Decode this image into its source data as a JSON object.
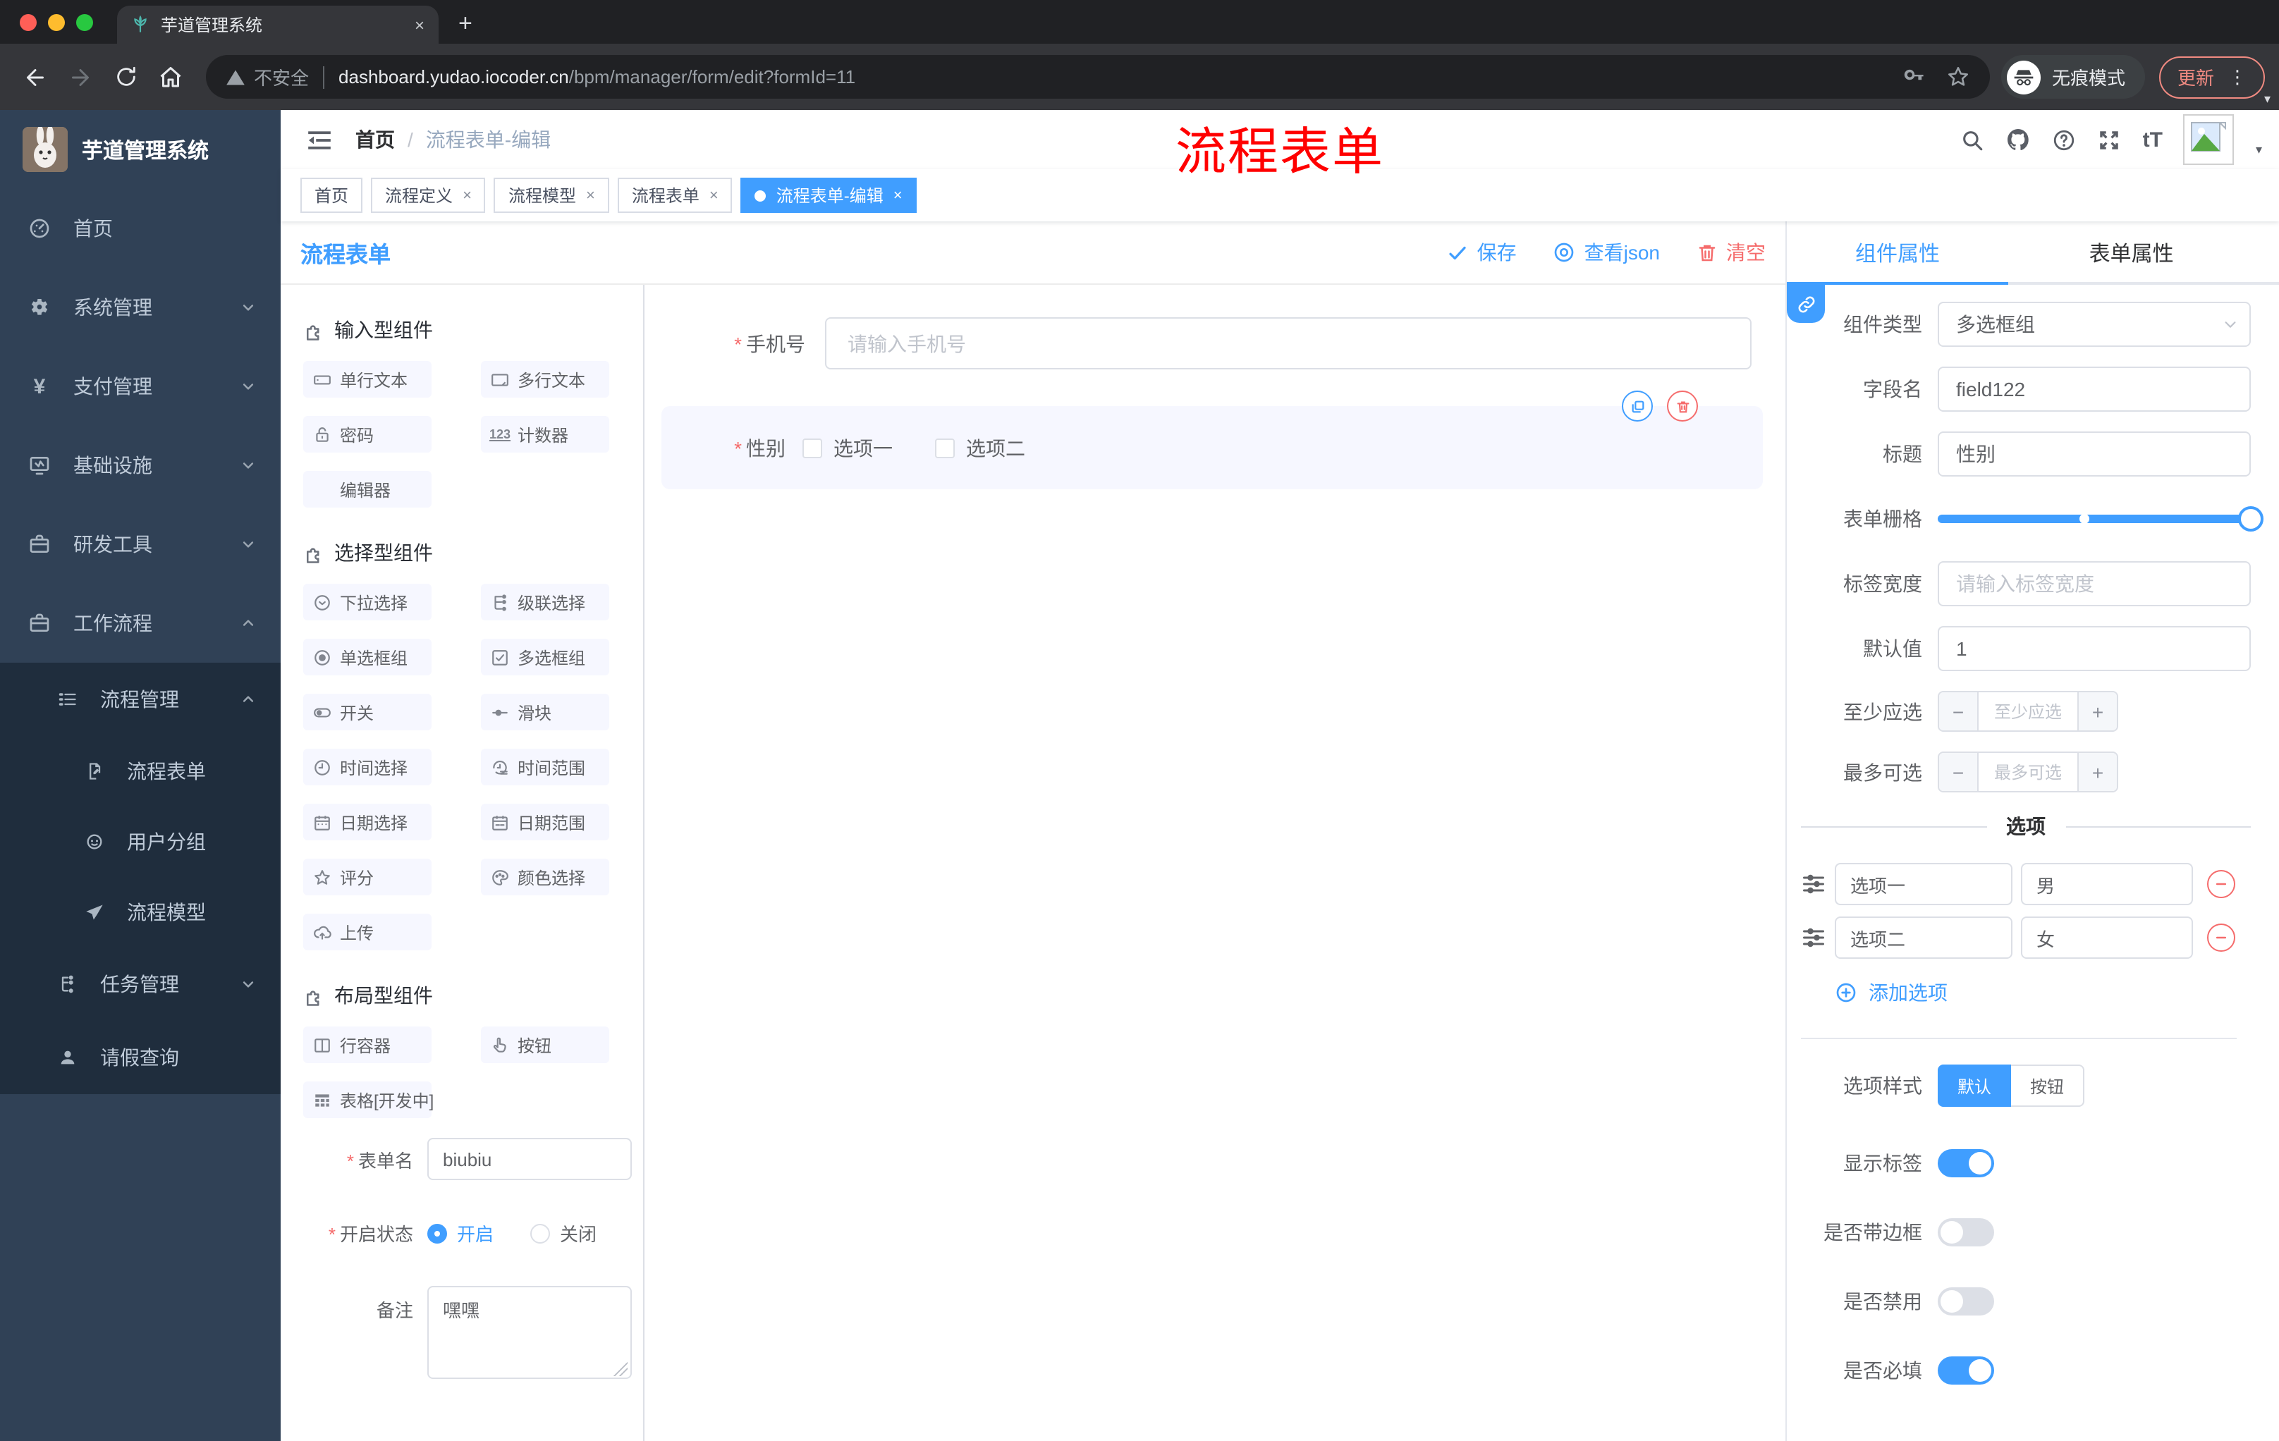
{
  "ui": {
    "close": "×",
    "plus": "+",
    "minus": "−",
    "caret": "▾",
    "dots": "⋮",
    "slash": "/"
  },
  "browser": {
    "tab_title": "芋道管理系统",
    "security_label": "不安全",
    "url_host": "dashboard.yudao.iocoder.cn",
    "url_path": "/bpm/manager/form/edit?formId=11",
    "incognito_label": "无痕模式",
    "update_label": "更新"
  },
  "sidebar": {
    "logo_title": "芋道管理系统",
    "items": [
      {
        "label": "首页"
      },
      {
        "label": "系统管理"
      },
      {
        "label": "支付管理"
      },
      {
        "label": "基础设施"
      },
      {
        "label": "研发工具"
      },
      {
        "label": "工作流程"
      },
      {
        "label": "流程管理"
      },
      {
        "label": "流程表单"
      },
      {
        "label": "用户分组"
      },
      {
        "label": "流程模型"
      },
      {
        "label": "任务管理"
      },
      {
        "label": "请假查询"
      }
    ]
  },
  "header": {
    "breadcrumb_home": "首页",
    "breadcrumb_current": "流程表单-编辑",
    "watermark": "流程表单",
    "font_size_icon_text": "tT"
  },
  "tags": [
    {
      "label": "首页",
      "closable": false,
      "active": false
    },
    {
      "label": "流程定义",
      "closable": true,
      "active": false
    },
    {
      "label": "流程模型",
      "closable": true,
      "active": false
    },
    {
      "label": "流程表单",
      "closable": true,
      "active": false
    },
    {
      "label": "流程表单-编辑",
      "closable": true,
      "active": true
    }
  ],
  "builder": {
    "title": "流程表单",
    "save_label": "保存",
    "view_json_label": "查看json",
    "clear_label": "清空"
  },
  "components": {
    "sections": [
      {
        "title": "输入型组件",
        "items": [
          {
            "label": "单行文本"
          },
          {
            "label": "多行文本"
          },
          {
            "label": "密码"
          },
          {
            "label": "计数器"
          },
          {
            "label": "编辑器"
          }
        ]
      },
      {
        "title": "选择型组件",
        "items": [
          {
            "label": "下拉选择"
          },
          {
            "label": "级联选择"
          },
          {
            "label": "单选框组"
          },
          {
            "label": "多选框组"
          },
          {
            "label": "开关"
          },
          {
            "label": "滑块"
          },
          {
            "label": "时间选择"
          },
          {
            "label": "时间范围"
          },
          {
            "label": "日期选择"
          },
          {
            "label": "日期范围"
          },
          {
            "label": "评分"
          },
          {
            "label": "颜色选择"
          },
          {
            "label": "上传"
          }
        ]
      },
      {
        "title": "布局型组件",
        "items": [
          {
            "label": "行容器"
          },
          {
            "label": "按钮"
          },
          {
            "label": "表格[开发中]"
          }
        ]
      }
    ],
    "form": {
      "name_label": "表单名",
      "name_value": "biubiu",
      "status_label": "开启状态",
      "status_on": "开启",
      "status_off": "关闭",
      "remark_label": "备注",
      "remark_value": "嘿嘿"
    }
  },
  "canvas": {
    "phone_label": "手机号",
    "phone_placeholder": "请输入手机号",
    "gender_label": "性别",
    "gender_option1": "选项一",
    "gender_option2": "选项二"
  },
  "panel": {
    "tab_component": "组件属性",
    "tab_form": "表单属性",
    "component_type_label": "组件类型",
    "component_type_value": "多选框组",
    "field_name_label": "字段名",
    "field_name_value": "field122",
    "title_label": "标题",
    "title_value": "性别",
    "grid_label": "表单栅格",
    "label_width_label": "标签宽度",
    "label_width_placeholder": "请输入标签宽度",
    "default_label": "默认值",
    "default_value": "1",
    "min_label": "至少应选",
    "min_placeholder": "至少应选",
    "max_label": "最多可选",
    "max_placeholder": "最多可选",
    "options_divider": "选项",
    "options": [
      {
        "name": "选项一",
        "value": "男"
      },
      {
        "name": "选项二",
        "value": "女"
      }
    ],
    "add_option_label": "添加选项",
    "style_label": "选项样式",
    "style_default": "默认",
    "style_button": "按钮",
    "switch_show_label": "显示标签",
    "switch_border_label": "是否带边框",
    "switch_disabled_label": "是否禁用",
    "switch_required_label": "是否必填",
    "switch_states": {
      "show_label": true,
      "border": false,
      "disabled": false,
      "required": true
    }
  },
  "colors": {
    "primary": "#409eff",
    "danger": "#f56c6c",
    "watermark_red": "#ff0000",
    "sidebar_bg": "#304156",
    "sidebar_submenu_bg": "#1f2d3d",
    "chip_bg": "#f6f7ff",
    "chrome_dark": "#202124",
    "chrome_toolbar": "#35363a",
    "update_accent": "#f28b82",
    "active_tag": "#409eff"
  }
}
